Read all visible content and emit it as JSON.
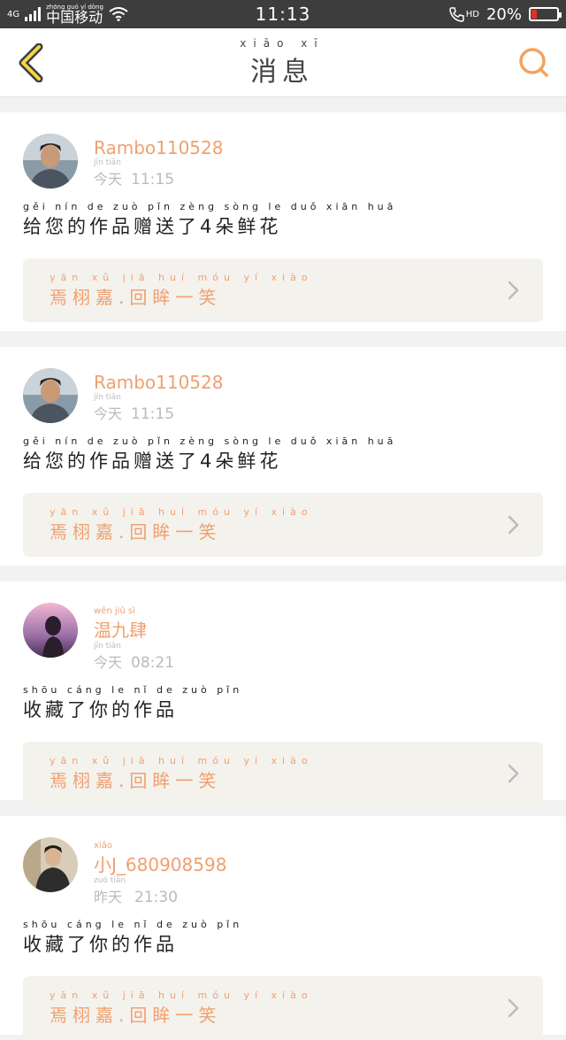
{
  "status_bar": {
    "network": "4G",
    "carrier_pinyin": "zhōng guó yí dòng",
    "carrier": "中国移动",
    "time": "11:13",
    "hd": "HD",
    "battery": "20%",
    "battery_level": 0.2,
    "battery_color": "#e3302a"
  },
  "header": {
    "title_pinyin": "xiāo xī",
    "title": "消息",
    "accent_color": "#f5a25d"
  },
  "messages": [
    {
      "user_pinyin": "",
      "user": "Rambo110528",
      "day_pinyin": "jīn tiān",
      "day": "今天",
      "time": "11:15",
      "action_pinyin": "gěi nín de zuò pǐn zèng sòng le duǒ xiān huā",
      "action": "给您的作品赠送了4朵鲜花",
      "reply_pinyin": "yān xǔ jiā huí móu yí xiào",
      "reply": "焉栩嘉.回眸一笑",
      "avatar": "man-portrait"
    },
    {
      "user_pinyin": "",
      "user": "Rambo110528",
      "day_pinyin": "jīn tiān",
      "day": "今天",
      "time": "11:15",
      "action_pinyin": "gěi nín de zuò pǐn zèng sòng le duǒ xiān huā",
      "action": "给您的作品赠送了4朵鲜花",
      "reply_pinyin": "yān xǔ jiā huí móu yí xiào",
      "reply": "焉栩嘉.回眸一笑",
      "avatar": "man-portrait"
    },
    {
      "user_pinyin": "wēn jiǔ sì",
      "user": "温九肆",
      "day_pinyin": "jīn tiān",
      "day": "今天",
      "time": "08:21",
      "action_pinyin": "shōu cáng le nǐ de zuò pǐn",
      "action": "收藏了你的作品",
      "reply_pinyin": "yān xǔ jiā huí móu yí xiào",
      "reply": "焉栩嘉.回眸一笑",
      "avatar": "sunset-silhouette"
    },
    {
      "user_pinyin": "xiǎo",
      "user": "小J_680908598",
      "day_pinyin": "zuó tiān",
      "day": "昨天",
      "time": "21:30",
      "action_pinyin": "shōu cáng le nǐ de zuò pǐn",
      "action": "收藏了你的作品",
      "reply_pinyin": "yān xǔ jiā huí móu yí xiào",
      "reply": "焉栩嘉.回眸一笑",
      "avatar": "person-portrait"
    }
  ]
}
